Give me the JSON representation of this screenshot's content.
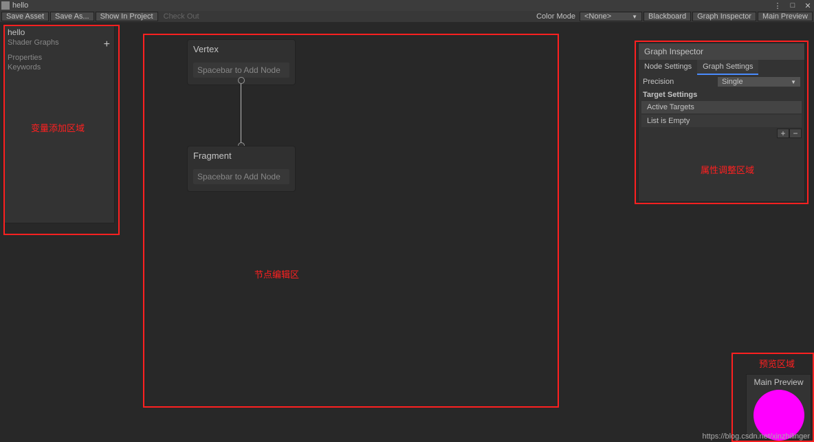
{
  "window": {
    "title": "hello",
    "kebab": "⋮",
    "maximize": "□",
    "close": "✕"
  },
  "toolbar": {
    "save_asset": "Save Asset",
    "save_as": "Save As...",
    "show_in_project": "Show In Project",
    "check_out": "Check Out",
    "color_mode_label": "Color Mode",
    "color_mode_value": "<None>",
    "blackboard": "Blackboard",
    "graph_inspector": "Graph Inspector",
    "main_preview": "Main Preview"
  },
  "blackboard": {
    "title": "hello",
    "subtitle": "Shader Graphs",
    "sections": [
      "Properties",
      "Keywords"
    ],
    "add": "+",
    "annotation": "变量添加区域"
  },
  "nodes": {
    "vertex": {
      "title": "Vertex",
      "hint": "Spacebar to Add Node"
    },
    "fragment": {
      "title": "Fragment",
      "hint": "Spacebar to Add Node"
    },
    "annotation": "节点编辑区"
  },
  "inspector": {
    "title": "Graph Inspector",
    "tabs": {
      "node": "Node Settings",
      "graph": "Graph Settings"
    },
    "precision_label": "Precision",
    "precision_value": "Single",
    "target_settings": "Target Settings",
    "active_targets": "Active Targets",
    "empty": "List is Empty",
    "add": "+",
    "remove": "−",
    "annotation": "属性调整区域"
  },
  "preview": {
    "title": "Main Preview",
    "annotation": "预览区域"
  },
  "watermark": "https://blog.csdn.net/xinzhilinger"
}
